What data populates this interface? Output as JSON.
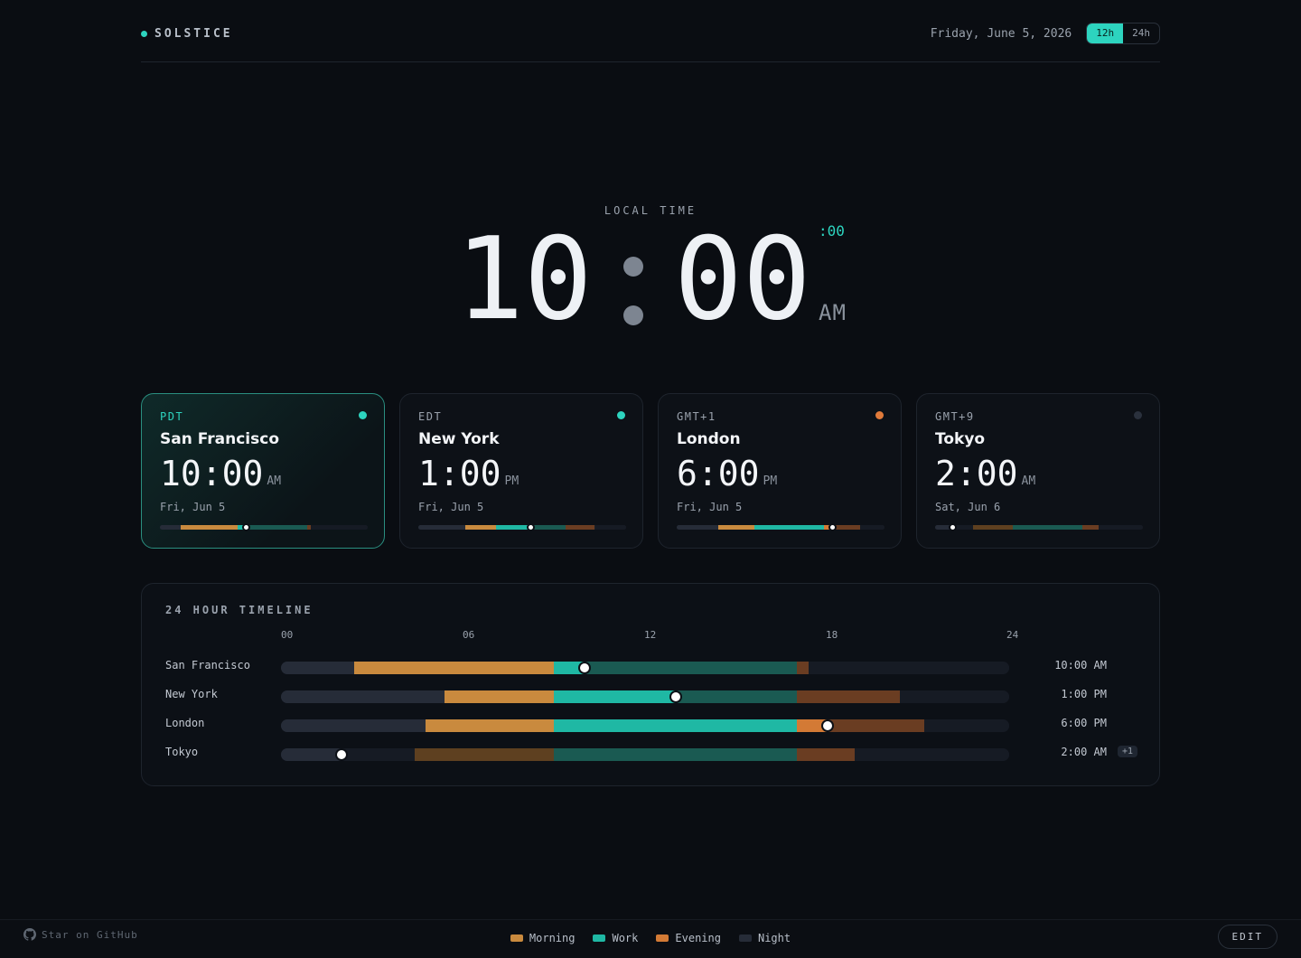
{
  "brand": {
    "name": "SOLSTICE",
    "accent": "#2dd4bf"
  },
  "header": {
    "date": "Friday, June 5, 2026",
    "toggle": [
      {
        "label": "12h",
        "active": true
      },
      {
        "label": "24h",
        "active": false
      }
    ]
  },
  "hero": {
    "label": "LOCAL TIME",
    "hours": "10",
    "minutes": "00",
    "seconds": ":00",
    "ampm": "AM"
  },
  "colors": {
    "morning": "#c98a3e",
    "work": "#1fb8a4",
    "work_dim": "#1a5a52",
    "evening": "#d37a35",
    "evening_dim": "#6a3d22",
    "morning_dim": "#5e4020",
    "night": "#262c38",
    "track": "#161b24"
  },
  "cards": [
    {
      "tz": "PDT",
      "city": "San Francisco",
      "time": "10:00",
      "ampm": "AM",
      "date": "Fri, Jun 5",
      "dot": "#2dd4bf",
      "active": true,
      "local_hour": 10
    },
    {
      "tz": "EDT",
      "city": "New York",
      "time": "1:00",
      "ampm": "PM",
      "date": "Fri, Jun 5",
      "dot": "#2dd4bf",
      "active": false,
      "local_hour": 13
    },
    {
      "tz": "GMT+1",
      "city": "London",
      "time": "6:00",
      "ampm": "PM",
      "date": "Fri, Jun 5",
      "dot": "#e07a3a",
      "active": false,
      "local_hour": 18
    },
    {
      "tz": "GMT+9",
      "city": "Tokyo",
      "time": "2:00",
      "ampm": "AM",
      "date": "Sat, Jun 6",
      "dot": "#2a313d",
      "active": false,
      "local_hour": 2
    }
  ],
  "timeline": {
    "title": "24 HOUR TIMELINE",
    "ticks": [
      "00",
      "06",
      "12",
      "18",
      "24"
    ],
    "rows": [
      {
        "city": "San Francisco",
        "time": "10:00 AM",
        "badge": "",
        "marker_hour": 10,
        "segments": [
          {
            "from": 0,
            "to": 2.4,
            "kind": "night"
          },
          {
            "from": 2.4,
            "to": 9,
            "kind": "morning"
          },
          {
            "from": 9,
            "to": 10,
            "kind": "work"
          },
          {
            "from": 10,
            "to": 17,
            "kind": "work_dim"
          },
          {
            "from": 17,
            "to": 17.4,
            "kind": "evening_dim"
          },
          {
            "from": 17.4,
            "to": 24,
            "kind": "track"
          }
        ]
      },
      {
        "city": "New York",
        "time": "1:00 PM",
        "badge": "",
        "marker_hour": 13,
        "segments": [
          {
            "from": 0,
            "to": 5.4,
            "kind": "night"
          },
          {
            "from": 5.4,
            "to": 9,
            "kind": "morning"
          },
          {
            "from": 9,
            "to": 13,
            "kind": "work"
          },
          {
            "from": 13,
            "to": 17,
            "kind": "work_dim"
          },
          {
            "from": 17,
            "to": 20.4,
            "kind": "evening_dim"
          },
          {
            "from": 20.4,
            "to": 24,
            "kind": "track"
          }
        ]
      },
      {
        "city": "London",
        "time": "6:00 PM",
        "badge": "",
        "marker_hour": 18,
        "segments": [
          {
            "from": 0,
            "to": 4.75,
            "kind": "night"
          },
          {
            "from": 4.75,
            "to": 9,
            "kind": "morning"
          },
          {
            "from": 9,
            "to": 17,
            "kind": "work"
          },
          {
            "from": 17,
            "to": 18,
            "kind": "evening"
          },
          {
            "from": 18,
            "to": 21.2,
            "kind": "evening_dim"
          },
          {
            "from": 21.2,
            "to": 24,
            "kind": "track"
          }
        ]
      },
      {
        "city": "Tokyo",
        "time": "2:00 AM",
        "badge": "+1",
        "marker_hour": 2,
        "segments": [
          {
            "from": 0,
            "to": 2,
            "kind": "night"
          },
          {
            "from": 2,
            "to": 4.4,
            "kind": "track"
          },
          {
            "from": 4.4,
            "to": 9,
            "kind": "morning_dim"
          },
          {
            "from": 9,
            "to": 17,
            "kind": "work_dim"
          },
          {
            "from": 17,
            "to": 18.9,
            "kind": "evening_dim"
          },
          {
            "from": 18.9,
            "to": 24,
            "kind": "track"
          }
        ]
      }
    ]
  },
  "footer": {
    "github": "Star on GitHub",
    "legend": [
      {
        "label": "Morning",
        "color": "#c98a3e"
      },
      {
        "label": "Work",
        "color": "#1fb8a4"
      },
      {
        "label": "Evening",
        "color": "#d37a35"
      },
      {
        "label": "Night",
        "color": "#262c38"
      }
    ],
    "edit": "EDIT"
  }
}
